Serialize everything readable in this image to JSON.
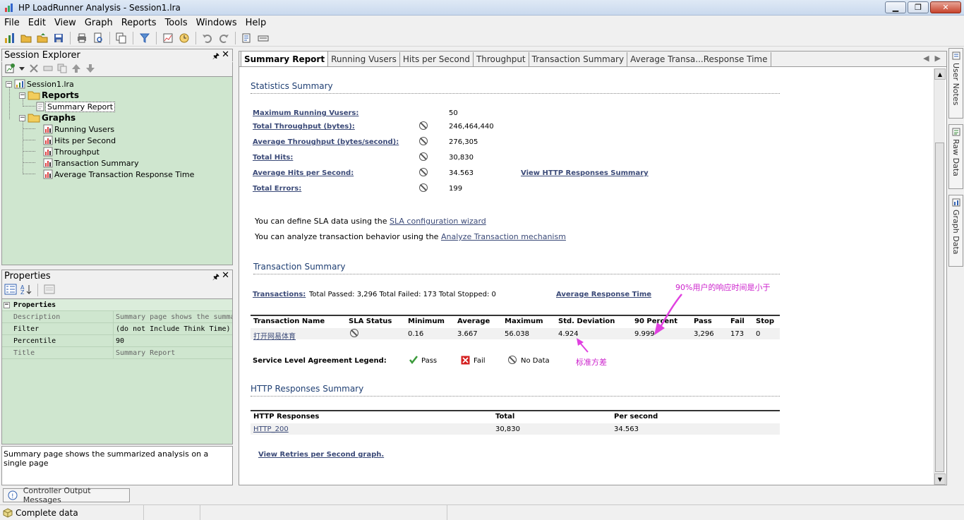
{
  "window": {
    "title": "HP LoadRunner Analysis - Session1.lra",
    "min": "▁",
    "max": "❐",
    "close": "✕"
  },
  "menu": [
    "File",
    "Edit",
    "View",
    "Graph",
    "Reports",
    "Tools",
    "Windows",
    "Help"
  ],
  "session_explorer": {
    "title": "Session Explorer",
    "pin": "🖈",
    "close": "✕",
    "tree": {
      "root": "Session1.lra",
      "reports_label": "Reports",
      "summary_report": "Summary Report",
      "graphs_label": "Graphs",
      "graphs": [
        "Running Vusers",
        "Hits per Second",
        "Throughput",
        "Transaction Summary",
        "Average Transaction Response Time"
      ]
    }
  },
  "properties": {
    "title": "Properties",
    "category": "Properties",
    "rows": [
      {
        "k": "Description",
        "v": "Summary page shows the summari"
      },
      {
        "k": "Filter",
        "v": "(do not Include Think Time)"
      },
      {
        "k": "Percentile",
        "v": "90"
      },
      {
        "k": "Title",
        "v": "Summary Report"
      }
    ],
    "description_box": "Summary page shows the summarized analysis on a single page"
  },
  "tabs": [
    "Summary Report",
    "Running Vusers",
    "Hits per Second",
    "Throughput",
    "Transaction Summary",
    "Average Transa...Response Time"
  ],
  "tab_nav": {
    "prev": "◀",
    "next": "▶"
  },
  "report": {
    "stats_title": "Statistics Summary",
    "stats": [
      {
        "label": "Maximum Running Vusers:",
        "value": "50",
        "icon": false
      },
      {
        "label": "Total Throughput (bytes):",
        "value": "246,464,440",
        "icon": true
      },
      {
        "label": "Average Throughput (bytes/second):",
        "value": "276,305",
        "icon": true
      },
      {
        "label": "Total Hits:",
        "value": "30,830",
        "icon": true
      },
      {
        "label": "Average Hits per Second:",
        "value": "34.563",
        "icon": true
      },
      {
        "label": "Total Errors:",
        "value": "199",
        "icon": true
      }
    ],
    "http_link": "View HTTP Responses Summary",
    "sla_text": "You can define SLA data using the ",
    "sla_link": "SLA configuration wizard",
    "analyze_text": "You can analyze transaction behavior using the ",
    "analyze_link": "Analyze Transaction mechanism",
    "trans_title": "Transaction Summary",
    "trans_link": "Transactions:",
    "trans_counts": "Total Passed: 3,296 Total Failed: 173 Total Stopped: 0",
    "avg_resp_link": "Average Response Time",
    "trans_headers": [
      "Transaction Name",
      "SLA Status",
      "Minimum",
      "Average",
      "Maximum",
      "Std. Deviation",
      "90 Percent",
      "Pass",
      "Fail",
      "Stop"
    ],
    "trans_row": {
      "name": "打开网易体育",
      "min": "0.16",
      "avg": "3.667",
      "max": "56.038",
      "std": "4.924",
      "p90": "9.999",
      "pass": "3,296",
      "fail": "173",
      "stop": "0"
    },
    "legend_label": "Service Level Agreement Legend:",
    "legend_pass": "Pass",
    "legend_fail": "Fail",
    "legend_nodata": "No Data",
    "http_title": "HTTP Responses Summary",
    "http_headers": [
      "HTTP Responses",
      "Total",
      "Per second"
    ],
    "http_row": {
      "name": "HTTP_200",
      "total": "30,830",
      "per_sec": "34.563"
    },
    "retries_link": "View Retries per Second graph.",
    "annotation_p90": "90%用户的响应时间是小于",
    "annotation_std": "标准方差"
  },
  "side_tabs": [
    "User Notes",
    "Raw Data",
    "Graph Data"
  ],
  "output_tab": "Controller Output Messages",
  "status": {
    "text": "Complete data"
  },
  "colors": {
    "tree_bg": "#cfe6cf",
    "link": "#3b4a78",
    "annotation": "#cc22cc"
  }
}
